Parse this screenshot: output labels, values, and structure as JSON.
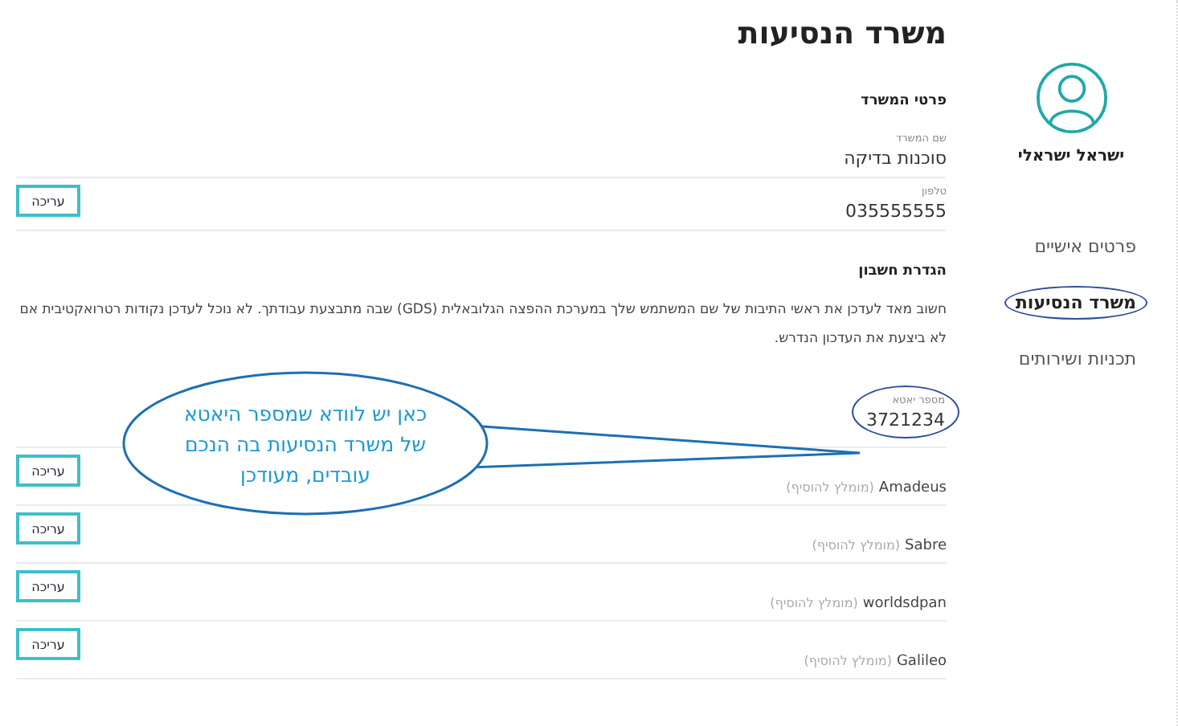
{
  "page_title": "משרד הנסיעות",
  "user": {
    "name": "ישראל ישראלי"
  },
  "nav": [
    {
      "label": "פרטים אישיים",
      "selected": false,
      "circled": false
    },
    {
      "label": "משרד הנסיעות",
      "selected": true,
      "circled": true
    },
    {
      "label": "תכניות ושירותים",
      "selected": false,
      "circled": false
    }
  ],
  "sections": [
    {
      "title": "פרטי המשרד",
      "fields": [
        {
          "kind": "labeled",
          "label": "שם המשרד",
          "value": "סוכנות בדיקה",
          "circled": false
        },
        {
          "kind": "labeled",
          "label": "טלפון",
          "value": "035555555",
          "button": "עריכה",
          "circled": false
        }
      ]
    },
    {
      "title": "הגדרת חשבון",
      "description": "חשוב מאד לעדכן את ראשי התיבות של שם המשתמש שלך במערכת ההפצה הגלובאלית (GDS) שבה מתבצעת עבודתך. לא נוכל לעדכן נקודות רטרואקטיבית אם לא ביצעת את העדכון הנדרש.",
      "fields": [
        {
          "kind": "labeled",
          "label": "מספר יאטא",
          "value": "3721234",
          "circled": true
        },
        {
          "kind": "system",
          "name": "Amadeus",
          "hint": "(מומלץ להוסיף)",
          "button": "עריכה"
        },
        {
          "kind": "system",
          "name": "Sabre",
          "hint": "(מומלץ להוסיף)",
          "button": "עריכה"
        },
        {
          "kind": "system",
          "name": "worldsdpan",
          "hint": "(מומלץ להוסיף)",
          "button": "עריכה"
        },
        {
          "kind": "system",
          "name": "Galileo",
          "hint": "(מומלץ להוסיף)",
          "button": "עריכה"
        }
      ]
    }
  ],
  "annotation": {
    "kind": "callout",
    "text": "כאן יש לוודא שמספר היאטא של משרד הנסיעות בה הנכם עובדים, מעודכן"
  }
}
